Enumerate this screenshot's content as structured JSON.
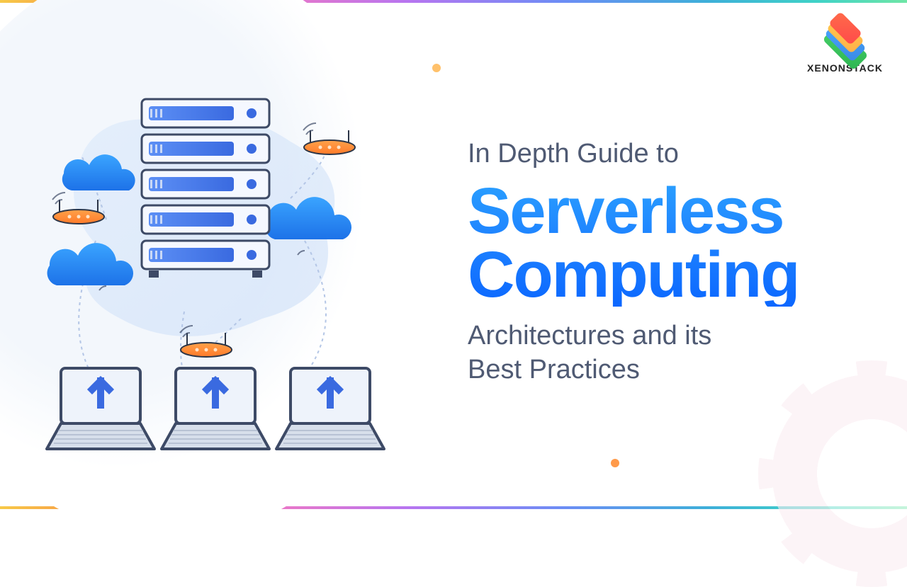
{
  "brand": {
    "name": "XENONSTACK"
  },
  "headline": {
    "pretitle": "In Depth Guide to",
    "title_line1": "Serverless",
    "title_line2": "Computing",
    "subtitle_line1": "Architectures and its",
    "subtitle_line2": "Best Practices"
  },
  "colors": {
    "accent_blue": "#1f84ff",
    "text_grey": "#4f5a73"
  }
}
